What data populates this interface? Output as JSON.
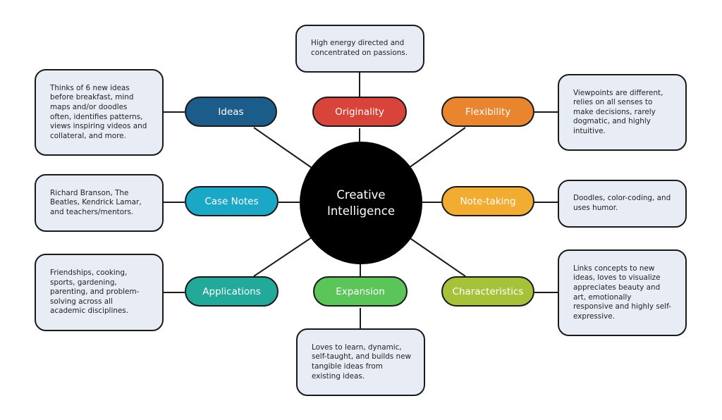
{
  "center": {
    "label_line1": "Creative",
    "label_line2": "Intelligence"
  },
  "nodes": {
    "originality": {
      "label": "Originality",
      "color": "#d9443a",
      "note": "High energy directed and concentrated on passions."
    },
    "ideas": {
      "label": "Ideas",
      "color": "#1b5c8a",
      "note": "Thinks of 6 new ideas before breakfast, mind maps and/or doodles often, identifies patterns, views inspiring videos and collateral, and more."
    },
    "flexibility": {
      "label": "Flexibility",
      "color": "#e9842f",
      "note": "Viewpoints are different, relies on all senses to make decisions, rarely dogmatic, and highly intuitive."
    },
    "case_notes": {
      "label": "Case Notes",
      "color": "#1ba7c6",
      "note": "Richard Branson, The Beatles, Kendrick Lamar, and teachers/mentors."
    },
    "note_taking": {
      "label": "Note-taking",
      "color": "#f2ac32",
      "note": "Doodles, color-coding, and uses humor."
    },
    "applications": {
      "label": "Applications",
      "color": "#23a99a",
      "note": "Friendships, cooking, sports, gardening, parenting, and problem-solving across all academic disciplines."
    },
    "expansion": {
      "label": "Expansion",
      "color": "#5cc55a",
      "note": "Loves to learn, dynamic, self-taught, and builds new tangible ideas from existing ideas."
    },
    "characteristics": {
      "label": "Characteristics",
      "color": "#a6c23a",
      "note": "Links concepts to new ideas, loves to visualize appreciates beauty and art, emotionally responsive and highly self-expressive."
    }
  }
}
